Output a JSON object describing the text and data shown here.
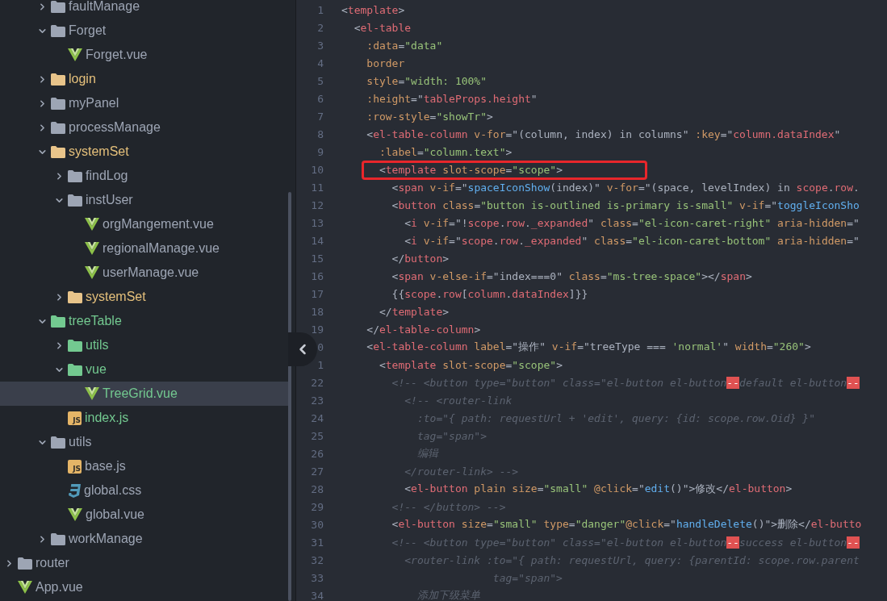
{
  "tree": [
    {
      "children": [
        {
          "name": "faultManage",
          "kind": "folder",
          "expanded": false,
          "modified": false,
          "added": false,
          "selected": false
        },
        {
          "name": "Forget",
          "kind": "folder",
          "expanded": true,
          "modified": false,
          "added": false,
          "selected": false,
          "children": [
            {
              "name": "Forget.vue",
              "kind": "vue",
              "modified": false,
              "added": false,
              "selected": false
            }
          ]
        },
        {
          "name": "login",
          "kind": "folder",
          "expanded": false,
          "modified": true,
          "added": false,
          "selected": false
        },
        {
          "name": "myPanel",
          "kind": "folder",
          "expanded": false,
          "modified": false,
          "added": false,
          "selected": false
        },
        {
          "name": "processManage",
          "kind": "folder",
          "expanded": false,
          "modified": false,
          "added": false,
          "selected": false
        },
        {
          "name": "systemSet",
          "kind": "folder",
          "expanded": true,
          "modified": true,
          "added": false,
          "selected": false,
          "children": [
            {
              "name": "findLog",
              "kind": "folder",
              "expanded": false,
              "modified": false,
              "added": false,
              "selected": false
            },
            {
              "name": "instUser",
              "kind": "folder",
              "expanded": true,
              "modified": false,
              "added": false,
              "selected": false,
              "children": [
                {
                  "name": "orgMangement.vue",
                  "kind": "vue",
                  "modified": false,
                  "added": false,
                  "selected": false
                },
                {
                  "name": "regionalManage.vue",
                  "kind": "vue",
                  "modified": false,
                  "added": false,
                  "selected": false
                },
                {
                  "name": "userManage.vue",
                  "kind": "vue",
                  "modified": false,
                  "added": false,
                  "selected": false
                }
              ]
            },
            {
              "name": "systemSet",
              "kind": "folder",
              "expanded": false,
              "modified": true,
              "added": false,
              "selected": false
            }
          ]
        },
        {
          "name": "treeTable",
          "kind": "folder",
          "expanded": true,
          "modified": false,
          "added": true,
          "selected": false,
          "children": [
            {
              "name": "utils",
              "kind": "folder",
              "expanded": false,
              "modified": false,
              "added": true,
              "selected": false
            },
            {
              "name": "vue",
              "kind": "folder",
              "expanded": true,
              "modified": false,
              "added": true,
              "selected": false,
              "children": [
                {
                  "name": "TreeGrid.vue",
                  "kind": "vue",
                  "modified": false,
                  "added": true,
                  "selected": true
                }
              ]
            },
            {
              "name": "index.js",
              "kind": "js",
              "badge": "JS",
              "modified": false,
              "added": true,
              "selected": false
            }
          ]
        },
        {
          "name": "utils",
          "kind": "folder",
          "expanded": true,
          "modified": false,
          "added": false,
          "selected": false,
          "children": [
            {
              "name": "base.js",
              "kind": "js",
              "badge": "JS",
              "modified": false,
              "added": false,
              "selected": false
            },
            {
              "name": "global.css",
              "kind": "css",
              "modified": false,
              "added": false,
              "selected": false
            },
            {
              "name": "global.vue",
              "kind": "vue",
              "modified": false,
              "added": false,
              "selected": false
            }
          ]
        },
        {
          "name": "workManage",
          "kind": "folder",
          "expanded": false,
          "modified": false,
          "added": false,
          "selected": false
        }
      ]
    },
    {
      "name": "router",
      "kind": "folder",
      "expanded": false,
      "modified": false,
      "added": false,
      "selected": false
    },
    {
      "name": "App.vue",
      "kind": "vue",
      "modified": false,
      "added": false,
      "selected": false
    }
  ],
  "editor": {
    "lines": [
      {
        "number": "1",
        "tokens": [
          {
            "kind": "plain",
            "text": "<"
          },
          {
            "kind": "tag",
            "text": "template"
          },
          {
            "kind": "plain",
            "text": ">"
          }
        ]
      },
      {
        "number": "2",
        "tokens": [
          {
            "kind": "plain",
            "text": "  <"
          },
          {
            "kind": "tag",
            "text": "el-table"
          }
        ]
      },
      {
        "number": "3",
        "tokens": [
          {
            "kind": "attr",
            "text": "    :data"
          },
          {
            "kind": "plain",
            "text": "="
          },
          {
            "kind": "string",
            "text": "\"data\""
          }
        ]
      },
      {
        "number": "4",
        "tokens": [
          {
            "kind": "attr",
            "text": "    border"
          }
        ]
      },
      {
        "number": "5",
        "tokens": [
          {
            "kind": "attr",
            "text": "    style"
          },
          {
            "kind": "plain",
            "text": "="
          },
          {
            "kind": "string",
            "text": "\"width: 100%\""
          }
        ]
      },
      {
        "number": "6",
        "tokens": [
          {
            "kind": "attr",
            "text": "    :height"
          },
          {
            "kind": "plain",
            "text": "=\""
          },
          {
            "kind": "var",
            "text": "tableProps.height"
          },
          {
            "kind": "plain",
            "text": "\""
          }
        ]
      },
      {
        "number": "7",
        "tokens": [
          {
            "kind": "attr",
            "text": "    :row-style"
          },
          {
            "kind": "plain",
            "text": "="
          },
          {
            "kind": "string",
            "text": "\"showTr\""
          },
          {
            "kind": "plain",
            "text": ">"
          }
        ]
      },
      {
        "number": "8",
        "tokens": [
          {
            "kind": "plain",
            "text": "    <"
          },
          {
            "kind": "tag",
            "text": "el-table-column"
          },
          {
            "kind": "attr",
            "text": " v-for"
          },
          {
            "kind": "plain",
            "text": "=\"(column, index) in columns\""
          },
          {
            "kind": "attr",
            "text": " :key"
          },
          {
            "kind": "plain",
            "text": "=\""
          },
          {
            "kind": "var",
            "text": "column.dataIndex"
          },
          {
            "kind": "plain",
            "text": "\""
          }
        ]
      },
      {
        "number": "9",
        "tokens": [
          {
            "kind": "attr",
            "text": "      :label"
          },
          {
            "kind": "plain",
            "text": "="
          },
          {
            "kind": "string",
            "text": "\"column.text\""
          },
          {
            "kind": "plain",
            "text": ">"
          }
        ]
      },
      {
        "number": "10",
        "boxed": true,
        "tokens": [
          {
            "kind": "plain",
            "text": "      <"
          },
          {
            "kind": "tag",
            "text": "template"
          },
          {
            "kind": "attr",
            "text": " slot-scope"
          },
          {
            "kind": "plain",
            "text": "="
          },
          {
            "kind": "string",
            "text": "\"scope\""
          },
          {
            "kind": "plain",
            "text": ">"
          }
        ]
      },
      {
        "number": "11",
        "tokens": [
          {
            "kind": "plain",
            "text": "        <"
          },
          {
            "kind": "tag",
            "text": "span"
          },
          {
            "kind": "attr",
            "text": " v-if"
          },
          {
            "kind": "plain",
            "text": "=\""
          },
          {
            "kind": "func",
            "text": "spaceIconShow"
          },
          {
            "kind": "plain",
            "text": "(index)\""
          },
          {
            "kind": "attr",
            "text": " v-for"
          },
          {
            "kind": "plain",
            "text": "=\"(space, levelIndex) in "
          },
          {
            "kind": "var",
            "text": "scope"
          },
          {
            "kind": "plain",
            "text": "."
          },
          {
            "kind": "var",
            "text": "row"
          },
          {
            "kind": "plain",
            "text": "."
          }
        ]
      },
      {
        "number": "12",
        "tokens": [
          {
            "kind": "plain",
            "text": "        <"
          },
          {
            "kind": "tag",
            "text": "button"
          },
          {
            "kind": "attr",
            "text": " class"
          },
          {
            "kind": "plain",
            "text": "="
          },
          {
            "kind": "string",
            "text": "\"button is-outlined is-primary is-small\""
          },
          {
            "kind": "attr",
            "text": " v-if"
          },
          {
            "kind": "plain",
            "text": "=\""
          },
          {
            "kind": "func",
            "text": "toggleIconSho"
          }
        ]
      },
      {
        "number": "13",
        "tokens": [
          {
            "kind": "plain",
            "text": "          <"
          },
          {
            "kind": "tag",
            "text": "i"
          },
          {
            "kind": "attr",
            "text": " v-if"
          },
          {
            "kind": "plain",
            "text": "=\"!"
          },
          {
            "kind": "var",
            "text": "scope"
          },
          {
            "kind": "plain",
            "text": "."
          },
          {
            "kind": "var",
            "text": "row"
          },
          {
            "kind": "plain",
            "text": "."
          },
          {
            "kind": "var",
            "text": "_expanded"
          },
          {
            "kind": "plain",
            "text": "\""
          },
          {
            "kind": "attr",
            "text": " class"
          },
          {
            "kind": "plain",
            "text": "="
          },
          {
            "kind": "string",
            "text": "\"el-icon-caret-right\""
          },
          {
            "kind": "attr",
            "text": " aria-hidden"
          },
          {
            "kind": "plain",
            "text": "=\""
          }
        ]
      },
      {
        "number": "14",
        "tokens": [
          {
            "kind": "plain",
            "text": "          <"
          },
          {
            "kind": "tag",
            "text": "i"
          },
          {
            "kind": "attr",
            "text": " v-if"
          },
          {
            "kind": "plain",
            "text": "=\""
          },
          {
            "kind": "var",
            "text": "scope"
          },
          {
            "kind": "plain",
            "text": "."
          },
          {
            "kind": "var",
            "text": "row"
          },
          {
            "kind": "plain",
            "text": "."
          },
          {
            "kind": "var",
            "text": "_expanded"
          },
          {
            "kind": "plain",
            "text": "\""
          },
          {
            "kind": "attr",
            "text": " class"
          },
          {
            "kind": "plain",
            "text": "="
          },
          {
            "kind": "string",
            "text": "\"el-icon-caret-bottom\""
          },
          {
            "kind": "attr",
            "text": " aria-hidden"
          },
          {
            "kind": "plain",
            "text": "=\""
          }
        ]
      },
      {
        "number": "15",
        "tokens": [
          {
            "kind": "plain",
            "text": "        </"
          },
          {
            "kind": "tag",
            "text": "button"
          },
          {
            "kind": "plain",
            "text": ">"
          }
        ]
      },
      {
        "number": "16",
        "tokens": [
          {
            "kind": "plain",
            "text": "        <"
          },
          {
            "kind": "tag",
            "text": "span"
          },
          {
            "kind": "attr",
            "text": " v-else-if"
          },
          {
            "kind": "plain",
            "text": "=\"index===0\""
          },
          {
            "kind": "attr",
            "text": " class"
          },
          {
            "kind": "plain",
            "text": "="
          },
          {
            "kind": "string",
            "text": "\"ms-tree-space\""
          },
          {
            "kind": "plain",
            "text": "></"
          },
          {
            "kind": "tag",
            "text": "span"
          },
          {
            "kind": "plain",
            "text": ">"
          }
        ]
      },
      {
        "number": "17",
        "tokens": [
          {
            "kind": "plain",
            "text": "        {{"
          },
          {
            "kind": "var",
            "text": "scope"
          },
          {
            "kind": "plain",
            "text": "."
          },
          {
            "kind": "var",
            "text": "row"
          },
          {
            "kind": "plain",
            "text": "["
          },
          {
            "kind": "var",
            "text": "column"
          },
          {
            "kind": "plain",
            "text": "."
          },
          {
            "kind": "var",
            "text": "dataIndex"
          },
          {
            "kind": "plain",
            "text": "]}}"
          }
        ]
      },
      {
        "number": "18",
        "tokens": [
          {
            "kind": "plain",
            "text": "      </"
          },
          {
            "kind": "tag",
            "text": "template"
          },
          {
            "kind": "plain",
            "text": ">"
          }
        ]
      },
      {
        "number": "19",
        "tokens": [
          {
            "kind": "plain",
            "text": "    </"
          },
          {
            "kind": "tag",
            "text": "el-table-column"
          },
          {
            "kind": "plain",
            "text": ">"
          }
        ]
      },
      {
        "number": "0",
        "tokens": [
          {
            "kind": "plain",
            "text": "    <"
          },
          {
            "kind": "tag",
            "text": "el-table-column"
          },
          {
            "kind": "attr",
            "text": " label"
          },
          {
            "kind": "plain",
            "text": "=\"操作\""
          },
          {
            "kind": "attr",
            "text": " v-if"
          },
          {
            "kind": "plain",
            "text": "=\"treeType === "
          },
          {
            "kind": "string",
            "text": "'normal'"
          },
          {
            "kind": "plain",
            "text": "\""
          },
          {
            "kind": "attr",
            "text": " width"
          },
          {
            "kind": "plain",
            "text": "="
          },
          {
            "kind": "string",
            "text": "\"260\""
          },
          {
            "kind": "plain",
            "text": ">"
          }
        ]
      },
      {
        "number": "1",
        "tokens": [
          {
            "kind": "plain",
            "text": "      <"
          },
          {
            "kind": "tag",
            "text": "template"
          },
          {
            "kind": "attr",
            "text": " slot-scope"
          },
          {
            "kind": "plain",
            "text": "="
          },
          {
            "kind": "string",
            "text": "\"scope\""
          },
          {
            "kind": "plain",
            "text": ">"
          }
        ]
      },
      {
        "number": "22",
        "tokens": [
          {
            "kind": "comment",
            "text": "        <!-- <button type=\"button\" class=\"el-button el-button"
          },
          {
            "kind": "invalid",
            "text": "--"
          },
          {
            "kind": "comment",
            "text": "default el-button"
          },
          {
            "kind": "invalid",
            "text": "--"
          }
        ]
      },
      {
        "number": "23",
        "tokens": [
          {
            "kind": "comment",
            "text": "          <!-- <router-link"
          }
        ]
      },
      {
        "number": "24",
        "tokens": [
          {
            "kind": "comment",
            "text": "            :to=\"{ path: requestUrl + 'edit', query: {id: scope.row.Oid} }\""
          }
        ]
      },
      {
        "number": "25",
        "tokens": [
          {
            "kind": "comment",
            "text": "            tag=\"span\">"
          }
        ]
      },
      {
        "number": "26",
        "tokens": [
          {
            "kind": "comment",
            "text": "            编辑"
          }
        ]
      },
      {
        "number": "27",
        "tokens": [
          {
            "kind": "comment",
            "text": "          </router-link> -->"
          }
        ]
      },
      {
        "number": "28",
        "tokens": [
          {
            "kind": "plain",
            "text": "          <"
          },
          {
            "kind": "tag",
            "text": "el-button"
          },
          {
            "kind": "attr",
            "text": " plain size"
          },
          {
            "kind": "plain",
            "text": "="
          },
          {
            "kind": "string",
            "text": "\"small\""
          },
          {
            "kind": "attr",
            "text": " @click"
          },
          {
            "kind": "plain",
            "text": "=\""
          },
          {
            "kind": "func",
            "text": "edit"
          },
          {
            "kind": "plain",
            "text": "()\">修改</"
          },
          {
            "kind": "tag",
            "text": "el-button"
          },
          {
            "kind": "plain",
            "text": ">"
          }
        ]
      },
      {
        "number": "29",
        "tokens": [
          {
            "kind": "comment",
            "text": "        <!-- </button> -->"
          }
        ]
      },
      {
        "number": "30",
        "tokens": [
          {
            "kind": "plain",
            "text": "        <"
          },
          {
            "kind": "tag",
            "text": "el-button"
          },
          {
            "kind": "attr",
            "text": " size"
          },
          {
            "kind": "plain",
            "text": "="
          },
          {
            "kind": "string",
            "text": "\"small\""
          },
          {
            "kind": "attr",
            "text": " type"
          },
          {
            "kind": "plain",
            "text": "="
          },
          {
            "kind": "string",
            "text": "\"danger\""
          },
          {
            "kind": "attr",
            "text": "@click"
          },
          {
            "kind": "plain",
            "text": "=\""
          },
          {
            "kind": "func",
            "text": "handleDelete"
          },
          {
            "kind": "plain",
            "text": "()\">删除</"
          },
          {
            "kind": "tag",
            "text": "el-butto"
          }
        ]
      },
      {
        "number": "31",
        "tokens": [
          {
            "kind": "comment",
            "text": "        <!-- <button type=\"button\" class=\"el-button el-button"
          },
          {
            "kind": "invalid",
            "text": "--"
          },
          {
            "kind": "comment",
            "text": "success el-button"
          },
          {
            "kind": "invalid",
            "text": "--"
          }
        ]
      },
      {
        "number": "32",
        "tokens": [
          {
            "kind": "comment",
            "text": "          <router-link :to=\"{ path: requestUrl, query: {parentId: scope.row.parent"
          }
        ]
      },
      {
        "number": "33",
        "tokens": [
          {
            "kind": "comment",
            "text": "                        tag=\"span\">"
          }
        ]
      },
      {
        "number": "34",
        "tokens": [
          {
            "kind": "comment",
            "text": "            添加下级菜单"
          }
        ]
      }
    ]
  }
}
